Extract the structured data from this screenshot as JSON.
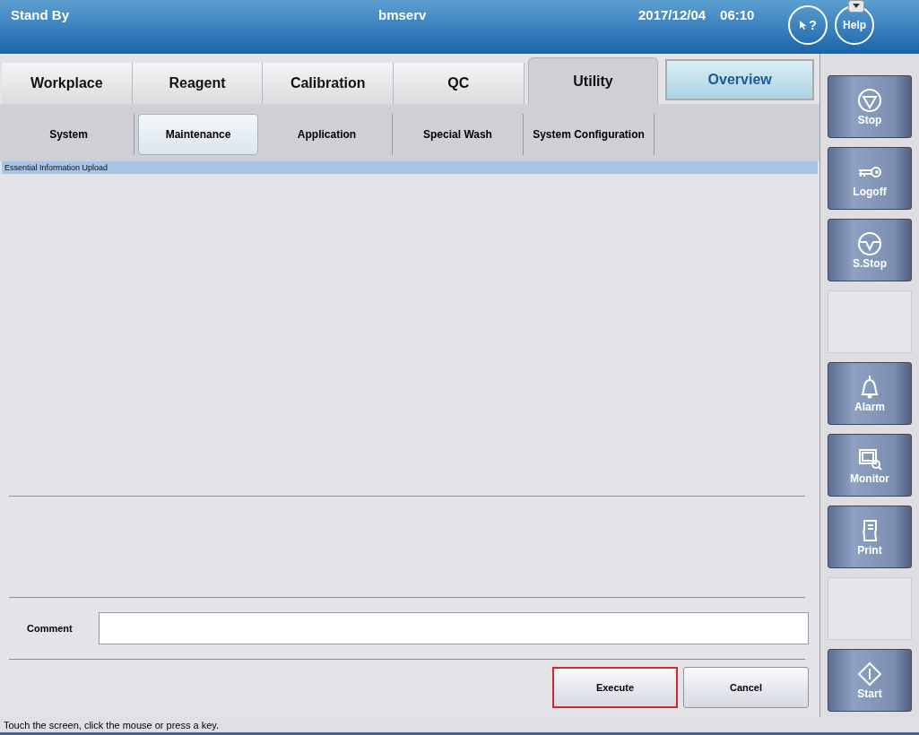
{
  "header": {
    "status": "Stand By",
    "user": "bmserv",
    "date": "2017/12/04",
    "time": "06:10",
    "help_cursor": "?",
    "help": "Help"
  },
  "tabs": [
    {
      "label": "Workplace",
      "selected": false
    },
    {
      "label": "Reagent",
      "selected": false
    },
    {
      "label": "Calibration",
      "selected": false
    },
    {
      "label": "QC",
      "selected": false
    },
    {
      "label": "Utility",
      "selected": true
    }
  ],
  "overview": "Overview",
  "subtabs": [
    {
      "label": "System",
      "selected": false
    },
    {
      "label": "Maintenance",
      "selected": true
    },
    {
      "label": "Application",
      "selected": false
    },
    {
      "label": "Special Wash",
      "selected": false
    },
    {
      "label": "System Configuration",
      "selected": false
    }
  ],
  "panel": {
    "title": "Essential Information Upload",
    "comment_label": "Comment",
    "buttons": [
      {
        "label": "Execute",
        "focused": true
      },
      {
        "label": "Cancel",
        "focused": false
      }
    ]
  },
  "side_buttons": [
    {
      "kind": "stop",
      "label": "Stop"
    },
    {
      "kind": "key",
      "label": "Logoff"
    },
    {
      "kind": "slow-stop",
      "label": "S.Stop"
    },
    {
      "kind": "empty"
    },
    {
      "kind": "bell",
      "label": "Alarm"
    },
    {
      "kind": "monitor",
      "label": "Monitor"
    },
    {
      "kind": "print",
      "label": "Print"
    },
    {
      "kind": "empty"
    },
    {
      "kind": "start",
      "label": "Start"
    }
  ],
  "status_bar": "Touch the screen, click the mouse or press a key."
}
